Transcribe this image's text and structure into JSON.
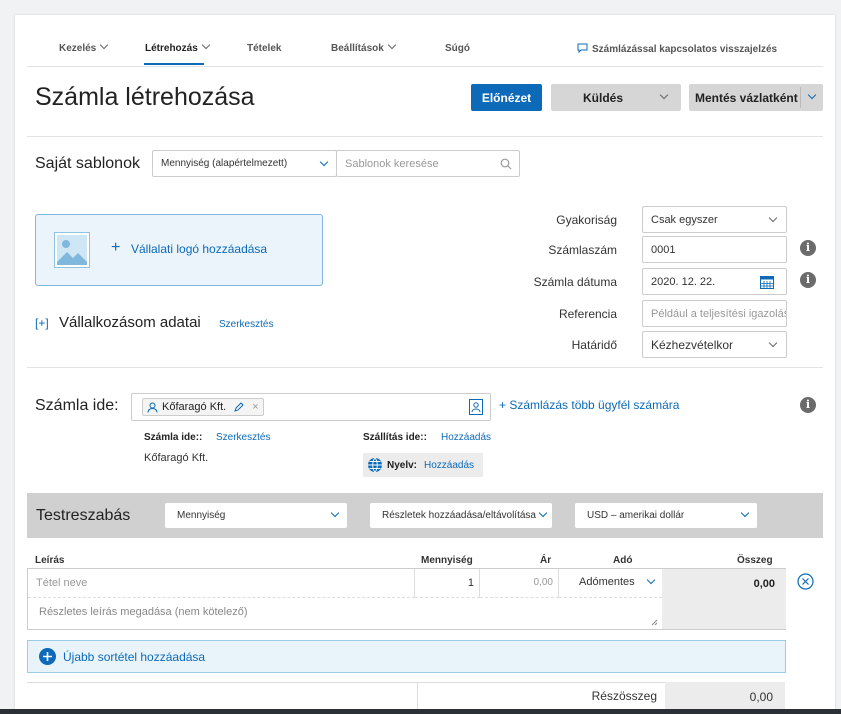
{
  "nav": {
    "items": [
      "Kezelés",
      "Létrehozás",
      "Tételek",
      "Beállítások",
      "Súgó"
    ],
    "feedback": "Számlázással kapcsolatos visszajelzés"
  },
  "header": {
    "title": "Számla létrehozása",
    "preview": "Előnézet",
    "send": "Küldés",
    "save_draft": "Mentés vázlatként"
  },
  "templates": {
    "label": "Saját sablonok",
    "selected": "Mennyiség (alapértelmezett)",
    "search_placeholder": "Sablonok keresése"
  },
  "logo": {
    "add_label": "Vállalati logó hozzáadása"
  },
  "business": {
    "toggle": "[+]",
    "title": "Vállalkozásom adatai",
    "edit": "Szerkesztés"
  },
  "invoice_meta": {
    "frequency_label": "Gyakoriság",
    "frequency_value": "Csak egyszer",
    "number_label": "Számlaszám",
    "number_value": "0001",
    "date_label": "Számla dátuma",
    "date_value": "2020. 12. 22.",
    "reference_label": "Referencia",
    "reference_placeholder": "Például a teljesítési igazolás",
    "due_label": "Határidő",
    "due_value": "Kézhezvételkor"
  },
  "bill_to": {
    "label": "Számla ide:",
    "chip": "Kőfaragó Kft.",
    "multi_link": "+ Számlázás több ügyfél számára",
    "billto_title": "Számla ide::",
    "billto_edit": "Szerkesztés",
    "billto_name": "Kőfaragó Kft.",
    "ship_title": "Szállítás ide::",
    "ship_add": "Hozzáadás",
    "lang_title": "Nyelv:",
    "lang_add": "Hozzáadás"
  },
  "customize": {
    "title": "Testreszabás",
    "qty_select": "Mennyiség",
    "details_select": "Részletek hozzáadása/eltávolítása",
    "currency_select": "USD – amerikai dollár"
  },
  "table": {
    "headers": {
      "desc": "Leírás",
      "qty": "Mennyiség",
      "price": "Ár",
      "tax": "Adó",
      "amount": "Összeg"
    },
    "row": {
      "name_placeholder": "Tétel neve",
      "qty": "1",
      "price": "0,00",
      "tax": "Adómentes",
      "amount": "0,00",
      "desc_placeholder": "Részletes leírás megadása (nem kötelező)"
    },
    "add_line": "Újabb sortétel hozzáadása",
    "subtotal_label": "Részösszeg",
    "subtotal_value": "0,00"
  },
  "colors": {
    "accent": "#0c6ab8",
    "customize_bar": "#d0d0d0",
    "add_line_bg": "#e8f4fa"
  }
}
